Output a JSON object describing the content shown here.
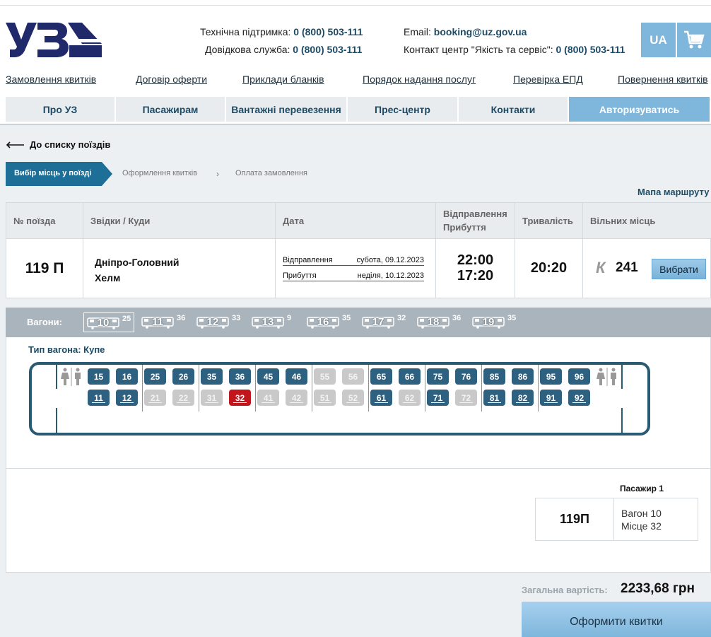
{
  "header": {
    "support_label": "Технічна підтримка:",
    "support_phone": "0 (800) 503-111",
    "info_label": "Довідкова служба:",
    "info_phone": "0 (800) 503-111",
    "email_label": "Email:",
    "email": "booking@uz.gov.ua",
    "contact_label": "Контакт центр \"Якість та сервіс\":",
    "contact_phone": "0 (800) 503-111",
    "lang": "UA",
    "logo_icon": "uz-logo",
    "cart_icon": "cart-icon",
    "accent_color": "#7fb6db",
    "brand_color": "#1d4b66"
  },
  "links": [
    "Замовлення квитків",
    "Договір оферти",
    "Приклади бланків",
    "Порядок надання послуг",
    "Перевірка ЕПД",
    "Повернення квитків"
  ],
  "nav": [
    "Про УЗ",
    "Пасажирам",
    "Вантажні перевезення",
    "Прес-центр",
    "Контакти",
    "Авторизуватись"
  ],
  "back_label": "До списку поїздів",
  "steps": [
    "Вибір місць у поїзді",
    "Оформлення квитків",
    "Оплата замовлення"
  ],
  "map_link": "Мапа маршруту",
  "table": {
    "headers": [
      "№ поїзда",
      "Звідки / Куди",
      "Дата",
      "Відправлення Прибуття",
      "Тривалість",
      "Вільних місць"
    ],
    "train": "119 П",
    "from": "Дніпро-Головний",
    "to": "Хелм",
    "dep_label": "Відправлення",
    "dep_date": "субота, 09.12.2023",
    "arr_label": "Прибуття",
    "arr_date": "неділя, 10.12.2023",
    "dep_time": "22:00",
    "arr_time": "17:20",
    "duration": "20:20",
    "class": "К",
    "free": "241",
    "choose": "Вибрати"
  },
  "wagons_label": "Вагони:",
  "wagons": [
    {
      "num": "10",
      "free": "25",
      "selected": true
    },
    {
      "num": "11",
      "free": "36"
    },
    {
      "num": "12",
      "free": "33"
    },
    {
      "num": "13",
      "free": "9"
    },
    {
      "num": "16",
      "free": "35"
    },
    {
      "num": "17",
      "free": "32"
    },
    {
      "num": "18",
      "free": "36"
    },
    {
      "num": "19",
      "free": "35"
    }
  ],
  "wagon_type": "Тип вагона: Купе",
  "seats_top": [
    [
      "15",
      "free"
    ],
    [
      "16",
      "free"
    ],
    [
      "25",
      "free"
    ],
    [
      "26",
      "free"
    ],
    [
      "35",
      "free"
    ],
    [
      "36",
      "free"
    ],
    [
      "45",
      "free"
    ],
    [
      "46",
      "free"
    ],
    [
      "55",
      "busy"
    ],
    [
      "56",
      "busy"
    ],
    [
      "65",
      "free"
    ],
    [
      "66",
      "free"
    ],
    [
      "75",
      "free"
    ],
    [
      "76",
      "free"
    ],
    [
      "85",
      "free"
    ],
    [
      "86",
      "free"
    ],
    [
      "95",
      "free"
    ],
    [
      "96",
      "free"
    ]
  ],
  "seats_bottom": [
    [
      "11",
      "free"
    ],
    [
      "12",
      "free"
    ],
    [
      "21",
      "busy"
    ],
    [
      "22",
      "busy"
    ],
    [
      "31",
      "busy"
    ],
    [
      "32",
      "sel"
    ],
    [
      "41",
      "busy"
    ],
    [
      "42",
      "busy"
    ],
    [
      "51",
      "busy"
    ],
    [
      "52",
      "busy"
    ],
    [
      "61",
      "free"
    ],
    [
      "62",
      "busy"
    ],
    [
      "71",
      "free"
    ],
    [
      "72",
      "busy"
    ],
    [
      "81",
      "free"
    ],
    [
      "82",
      "free"
    ],
    [
      "91",
      "free"
    ],
    [
      "92",
      "free"
    ]
  ],
  "seat_colors": {
    "free": "#2e6080",
    "busy": "#c9c9c9",
    "selected": "#c0161c"
  },
  "passenger": {
    "title": "Пасажир 1",
    "train": "119П",
    "wagon": "Вагон 10",
    "seat": "Місце 32"
  },
  "total": {
    "label": "Загальна вартість:",
    "value": "2233,68 грн"
  },
  "checkout": "Оформити квитки"
}
